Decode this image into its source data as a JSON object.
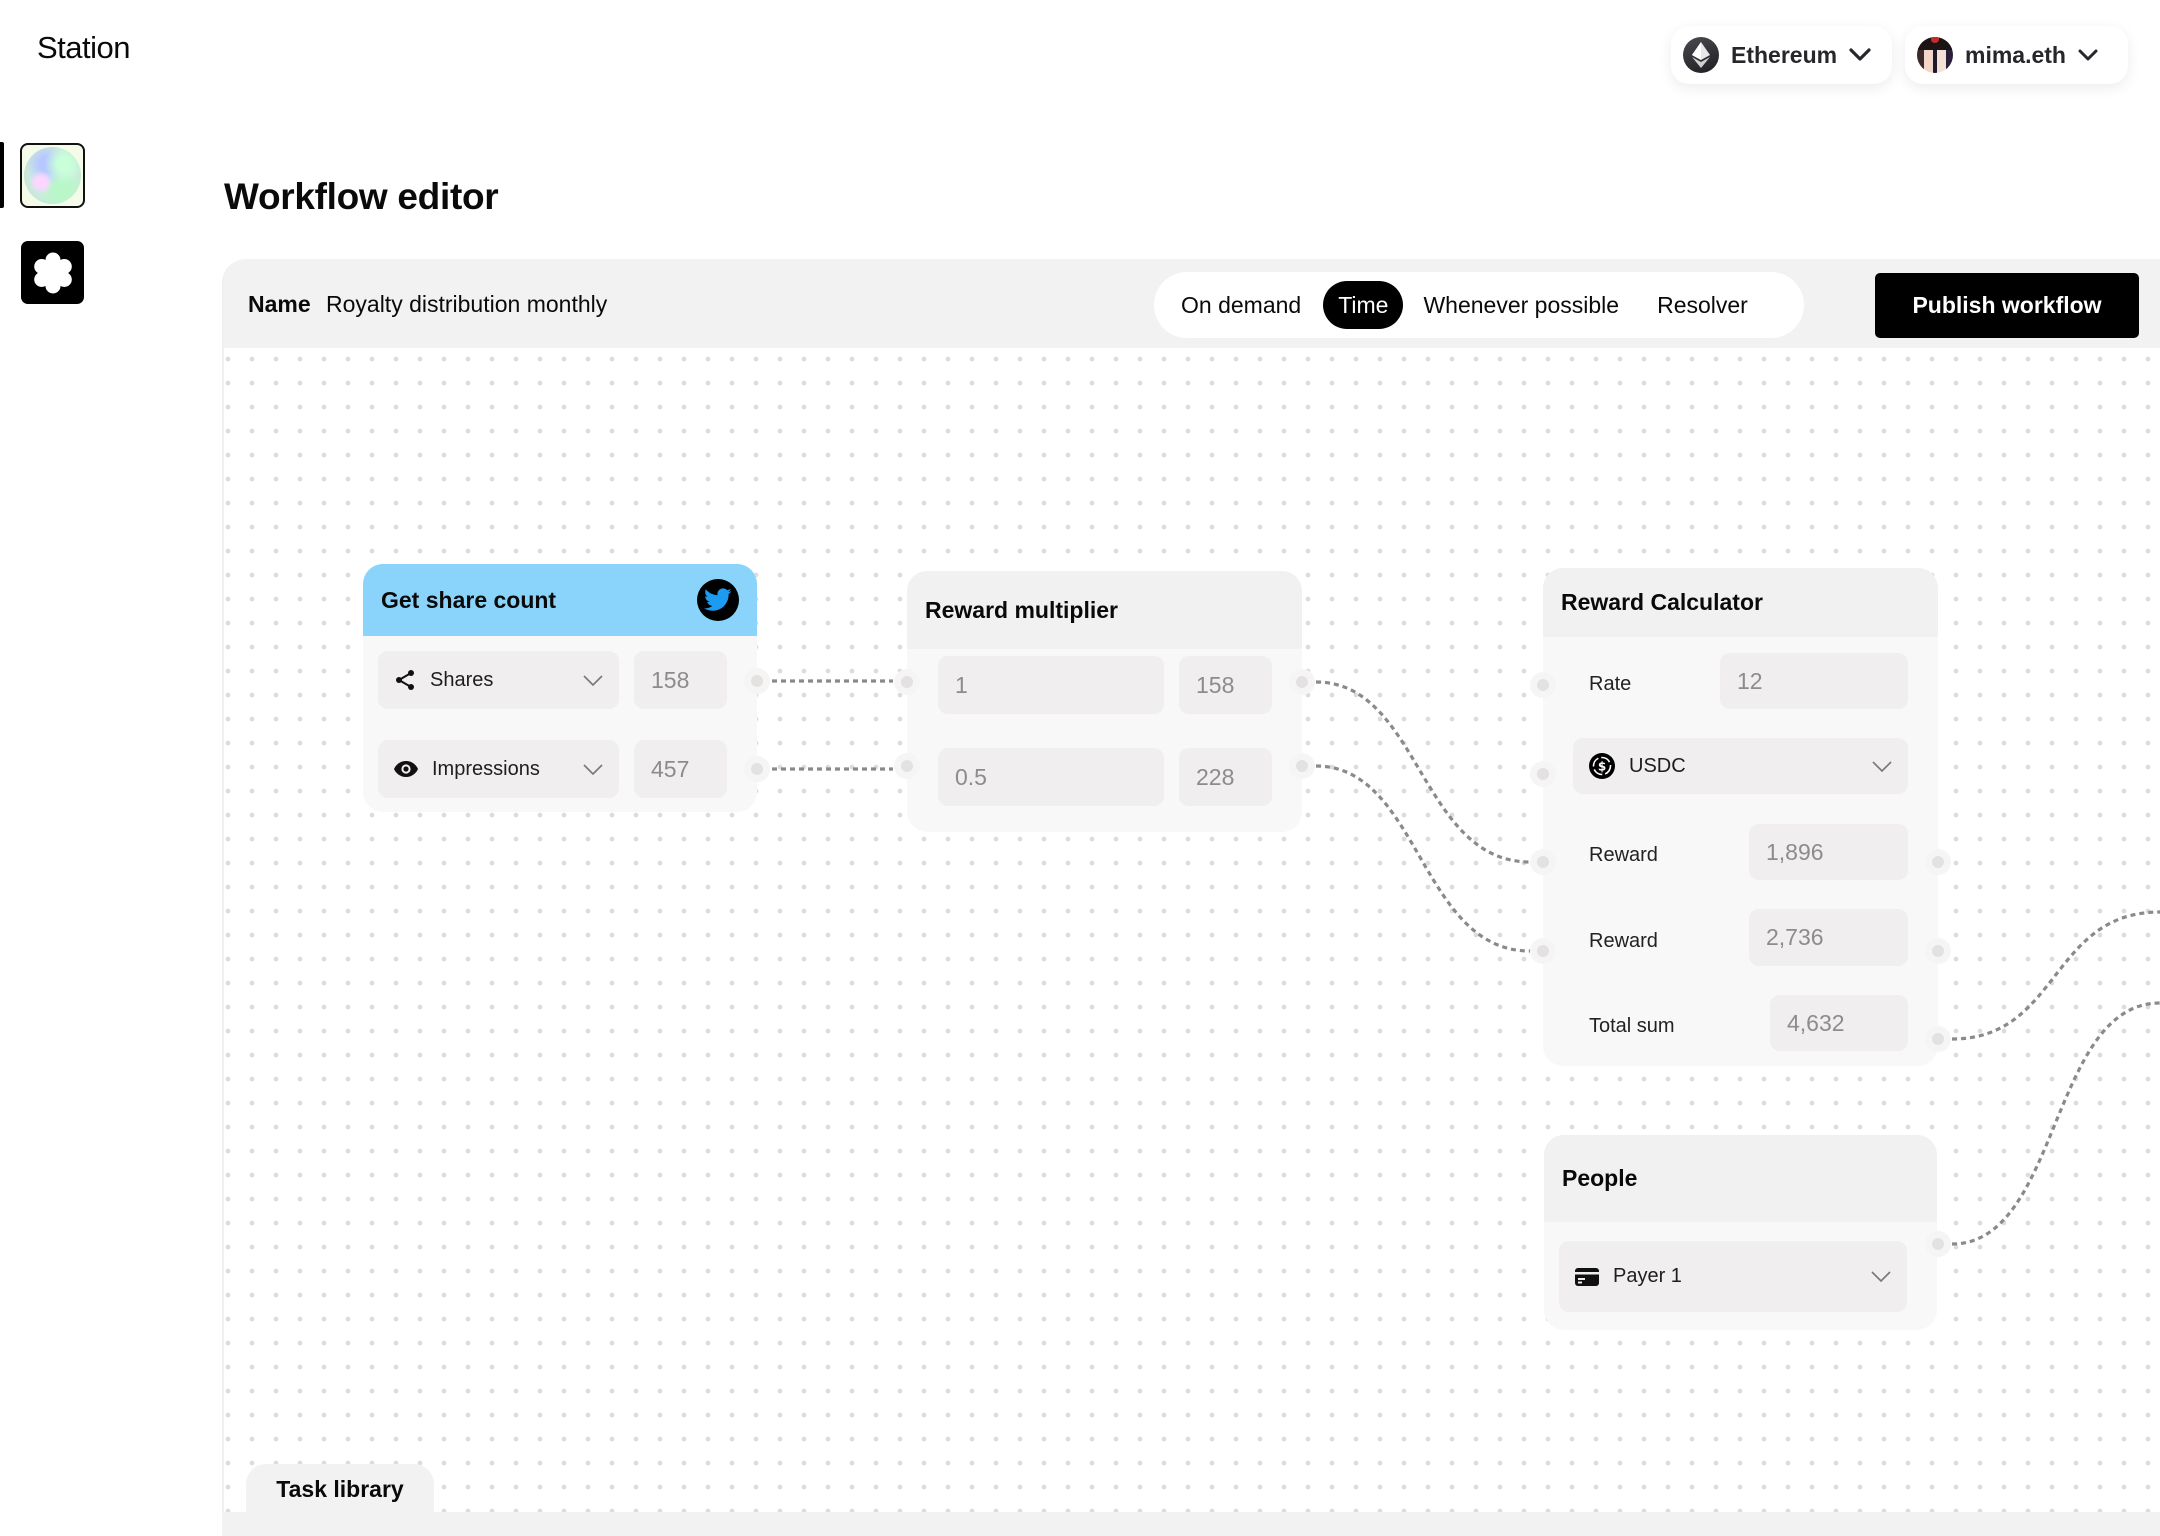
{
  "app": {
    "brand": "Station"
  },
  "nav": [
    {
      "name": "workspace-avatar",
      "active": true
    },
    {
      "name": "flower-app",
      "active": false
    }
  ],
  "topbar": {
    "network": {
      "label": "Ethereum",
      "icon": "ethereum-icon"
    },
    "account": {
      "label": "mima.eth",
      "icon": "avatar"
    }
  },
  "page": {
    "title": "Workflow editor"
  },
  "toolbar": {
    "name_label": "Name",
    "name_value": "Royalty distribution monthly",
    "trigger_options": [
      "On demand",
      "Time",
      "Whenever possible",
      "Resolver"
    ],
    "trigger_selected": "Time",
    "publish_label": "Publish workflow"
  },
  "nodes": {
    "share_count": {
      "title": "Get share count",
      "icon": "twitter-icon",
      "header_color": "#8ad4fc",
      "rows": [
        {
          "icon": "share-icon",
          "label": "Shares",
          "value": "158"
        },
        {
          "icon": "eye-icon",
          "label": "Impressions",
          "value": "457"
        }
      ]
    },
    "multiplier": {
      "title": "Reward multiplier",
      "rows": [
        {
          "factor": "1",
          "value": "158"
        },
        {
          "factor": "0.5",
          "value": "228"
        }
      ]
    },
    "calculator": {
      "title": "Reward Calculator",
      "rate_label": "Rate",
      "rate_value": "12",
      "currency": "USDC",
      "currency_icon": "usdc-icon",
      "reward1_label": "Reward",
      "reward1_value": "1,896",
      "reward2_label": "Reward",
      "reward2_value": "2,736",
      "total_label": "Total sum",
      "total_value": "4,632"
    },
    "people": {
      "title": "People",
      "payer": "Payer 1",
      "payer_icon": "card-icon"
    }
  },
  "footer": {
    "task_library_label": "Task library"
  },
  "colors": {
    "accent": "#000000",
    "twitter_blue": "#1d9bf0",
    "wire": "#8a8a8a",
    "canvas_toolbar": "#f2f2f2"
  }
}
